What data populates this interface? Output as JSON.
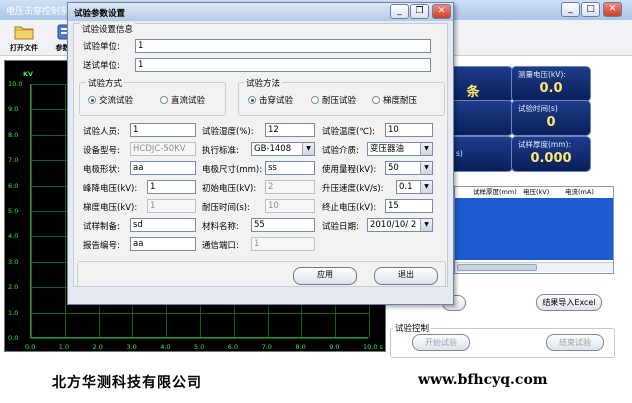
{
  "main": {
    "title": "电压击穿控制系",
    "toolbar": [
      {
        "label": "打开文件",
        "icon": "folder-icon"
      },
      {
        "label": "参数设",
        "icon": "settings-icon"
      }
    ],
    "window_buttons": [
      "minimize-icon",
      "maximize-icon",
      "close-icon"
    ]
  },
  "plot": {
    "y_unit": "KV",
    "y_ticks": [
      "10.0",
      "9.0",
      "8.0",
      "7.0",
      "6.0",
      "5.0",
      "4.0",
      "3.0",
      "2.0",
      "1.0",
      "0.0"
    ],
    "x_ticks": [
      "0.0",
      "1.0",
      "2.0",
      "3.0",
      "4.0",
      "5.0",
      "6.0",
      "7.0",
      "8.0",
      "9.0",
      "10.0 s"
    ]
  },
  "readouts": [
    {
      "label": "",
      "value": "条"
    },
    {
      "label": "测量电压(kV):",
      "value": "0.0"
    },
    {
      "label": "试验时间(s)",
      "value": "0"
    },
    {
      "label": "s)",
      "value": ""
    },
    {
      "label": "试样厚度(mm):",
      "value": "0.000"
    }
  ],
  "results_grid": {
    "columns": [
      "试样厚度(mm)",
      "电压(kV)",
      "电流(mA)"
    ]
  },
  "main_buttons": {
    "export": "结果导入Excel",
    "start": "开始试验",
    "stop": "结束试验"
  },
  "test_control_label": "试验控制",
  "footer": {
    "company": "北方华测科技有限公司",
    "url": "www.bfhcyq.com"
  },
  "dialog": {
    "title": "试验参数设置",
    "info_group": "试验设置信息",
    "test_unit_label": "试验单位:",
    "test_unit_value": "1",
    "send_unit_label": "送试单位:",
    "send_unit_value": "1",
    "mode_group": "试验方式",
    "modes": [
      {
        "label": "交流试验",
        "checked": true
      },
      {
        "label": "直流试验",
        "checked": false
      }
    ],
    "method_group": "试验方法",
    "methods": [
      {
        "label": "击穿试验",
        "checked": true
      },
      {
        "label": "耐压试验",
        "checked": false
      },
      {
        "label": "梯度耐压",
        "checked": false
      }
    ],
    "fields": {
      "personnel": {
        "label": "试验人员:",
        "value": "1"
      },
      "humidity": {
        "label": "试验湿度(%):",
        "value": "12"
      },
      "temperature": {
        "label": "试验温度(℃):",
        "value": "10"
      },
      "model": {
        "label": "设备型号:",
        "value": "HCDJC-50KV"
      },
      "standard": {
        "label": "执行标准:",
        "value": "GB-1408"
      },
      "medium": {
        "label": "试验介质:",
        "value": "变压器油"
      },
      "electrode_shape": {
        "label": "电极形状:",
        "value": "aa"
      },
      "electrode_size": {
        "label": "电极尺寸(mm):",
        "value": "ss"
      },
      "range": {
        "label": "使用量程(kV):",
        "value": "50"
      },
      "peak_drop": {
        "label": "峰降电压(kV):",
        "value": "1"
      },
      "initial_voltage": {
        "label": "初始电压(kV):",
        "value": "2"
      },
      "ramp_speed": {
        "label": "升压速度(kV/s):",
        "value": "0.1"
      },
      "gradient_voltage": {
        "label": "梯度电压(kV):",
        "value": "1"
      },
      "withstand_time": {
        "label": "耐压时间(s):",
        "value": "10"
      },
      "end_voltage": {
        "label": "终止电压(kV):",
        "value": "15"
      },
      "sample_prep": {
        "label": "试样制备:",
        "value": "sd"
      },
      "material": {
        "label": "材料名称:",
        "value": "55"
      },
      "test_date": {
        "label": "试验日期:",
        "value": "2010/10/ 2"
      },
      "report_no": {
        "label": "报告编号:",
        "value": "aa"
      },
      "comm_port": {
        "label": "通信端口:",
        "value": "1"
      }
    },
    "apply": "应用",
    "exit": "退出"
  }
}
